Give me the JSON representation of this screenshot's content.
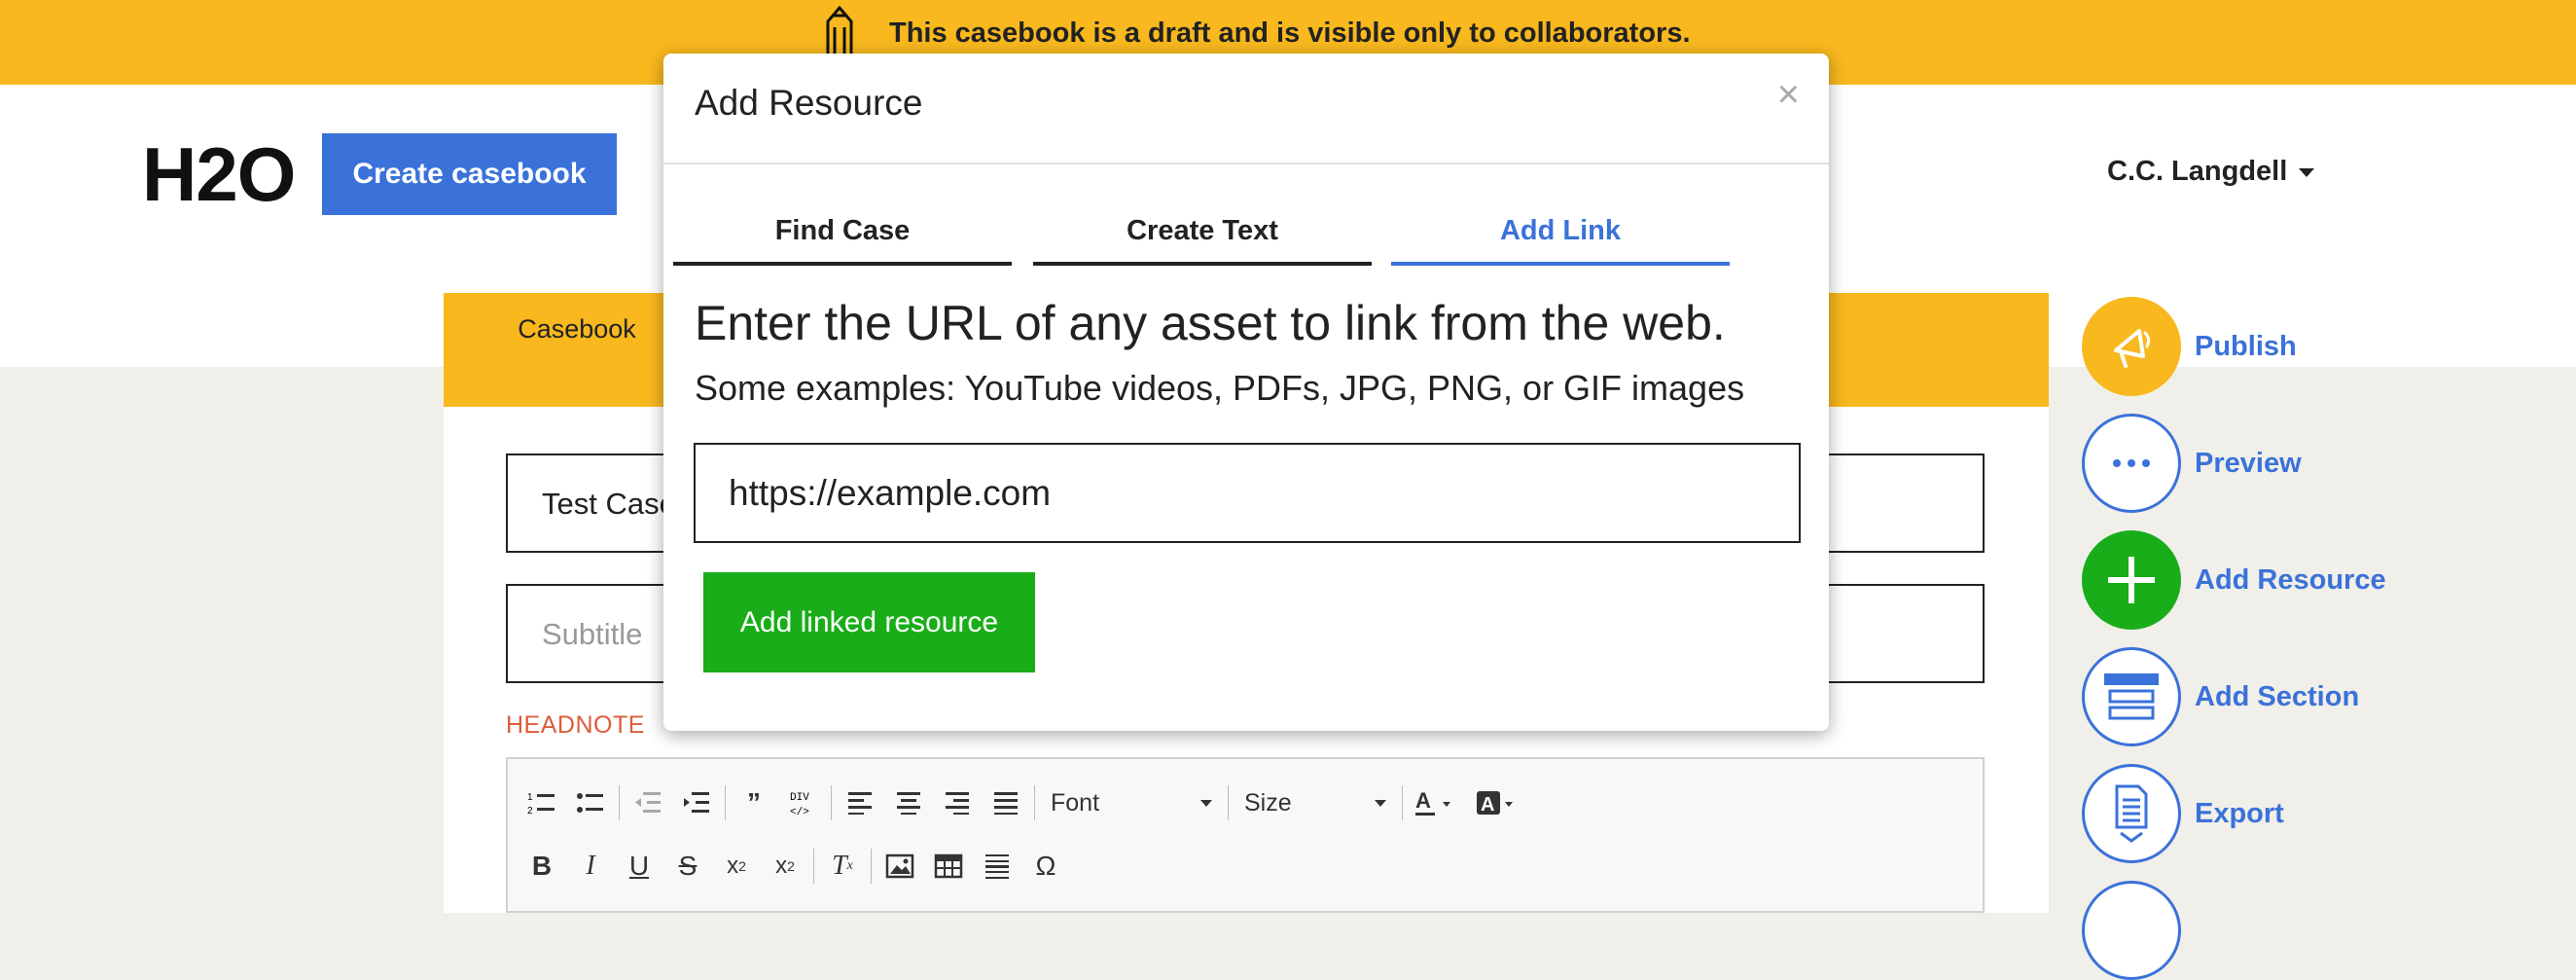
{
  "banner": {
    "text": "This casebook is a draft and is visible only to collaborators.",
    "icon": "pencil-icon"
  },
  "header": {
    "logo": "H2O",
    "create_label": "Create casebook",
    "user_name": "C.C. Langdell"
  },
  "casebook_tab": "Casebook",
  "editor": {
    "title_value": "Test Case",
    "subtitle_placeholder": "Subtitle",
    "headnote_label": "HEADNOTE",
    "toolbar": {
      "font_label": "Font",
      "size_label": "Size"
    }
  },
  "actions": [
    {
      "label": "Publish",
      "icon": "megaphone-icon"
    },
    {
      "label": "Preview",
      "icon": "ellipsis-icon"
    },
    {
      "label": "Add Resource",
      "icon": "plus-icon"
    },
    {
      "label": "Add Section",
      "icon": "section-icon"
    },
    {
      "label": "Export",
      "icon": "document-download-icon"
    }
  ],
  "modal": {
    "title": "Add Resource",
    "close": "×",
    "tabs": [
      "Find Case",
      "Create Text",
      "Add Link"
    ],
    "active_tab": "Add Link",
    "heading": "Enter the URL of any asset to link from the web.",
    "subheading": "Some examples: YouTube videos, PDFs, JPG, PNG, or GIF images",
    "url_value": "https://example.com",
    "submit_label": "Add linked resource"
  },
  "colors": {
    "banner": "#f8b81e",
    "primary_blue": "#3a72d9",
    "success_green": "#19ad19",
    "headnote_red": "#dc5d3a"
  }
}
